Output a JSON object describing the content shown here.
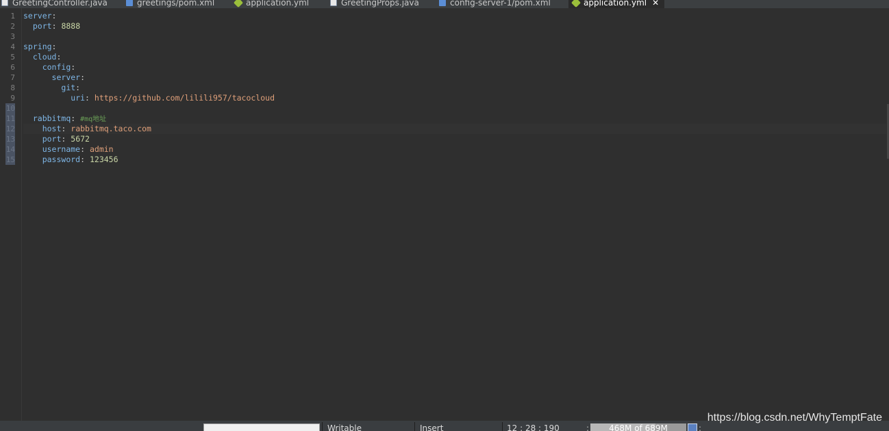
{
  "tabs": [
    {
      "label": "GreetingController.java",
      "icon": "java-file-icon",
      "active": false
    },
    {
      "label": "greetings/pom.xml",
      "icon": "maven-pom-icon",
      "active": false
    },
    {
      "label": "application.yml",
      "icon": "yaml-file-icon",
      "active": false
    },
    {
      "label": "GreetingProps.java",
      "icon": "java-file-icon",
      "active": false
    },
    {
      "label": "config-server-1/pom.xml",
      "icon": "maven-pom-icon",
      "active": false
    },
    {
      "label": "application.yml",
      "icon": "yaml-file-icon",
      "active": true,
      "close": "✕"
    }
  ],
  "editor": {
    "line_numbers": [
      "1",
      "2",
      "3",
      "4",
      "5",
      "6",
      "7",
      "8",
      "9",
      "10",
      "11",
      "12",
      "13",
      "14",
      "15"
    ],
    "lines": [
      {
        "key": "server",
        "sep": ":",
        "value": "",
        "comment": ""
      },
      {
        "key": "port",
        "sep": ":",
        "value": "8888",
        "comment": ""
      },
      {
        "key": "",
        "sep": "",
        "value": "",
        "comment": ""
      },
      {
        "key": "spring",
        "sep": ":",
        "value": "",
        "comment": ""
      },
      {
        "key": "cloud",
        "sep": ":",
        "value": "",
        "comment": ""
      },
      {
        "key": "config",
        "sep": ":",
        "value": "",
        "comment": ""
      },
      {
        "key": "server",
        "sep": ":",
        "value": "",
        "comment": ""
      },
      {
        "key": "git",
        "sep": ":",
        "value": "",
        "comment": ""
      },
      {
        "key": "uri",
        "sep": ":",
        "value": "https://github.com/lilili957/tacocloud",
        "comment": ""
      },
      {
        "key": "",
        "sep": "",
        "value": "",
        "comment": ""
      },
      {
        "key": "rabbitmq",
        "sep": ":",
        "value": "",
        "comment": "#mq地址"
      },
      {
        "key": "host",
        "sep": ":",
        "value": "rabbitmq.taco.com",
        "comment": ""
      },
      {
        "key": "port",
        "sep": ":",
        "value": "5672",
        "comment": ""
      },
      {
        "key": "username",
        "sep": ":",
        "value": "admin",
        "comment": ""
      },
      {
        "key": "password",
        "sep": ":",
        "value": "123456",
        "comment": ""
      }
    ]
  },
  "status": {
    "writable": "Writable",
    "insert_mode": "Insert",
    "position": "12 : 28 : 190",
    "heap": "468M of 689M",
    "heap_fraction": 0.68
  },
  "watermark": "https://blog.csdn.net/WhyTemptFate"
}
